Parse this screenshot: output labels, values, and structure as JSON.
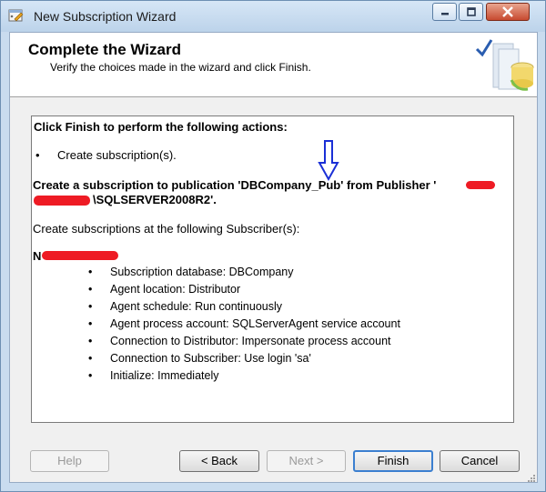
{
  "window": {
    "title": "New Subscription Wizard"
  },
  "header": {
    "title": "Complete the Wizard",
    "subtitle": "Verify the choices made in the wizard and click Finish."
  },
  "summary": {
    "heading": "Click Finish to perform the following actions:",
    "actions": [
      "Create subscription(s)."
    ],
    "publication_line1": "Create a subscription to publication 'DBCompany_Pub' from Publisher '",
    "publication_line2": "\\SQLSERVER2008R2'.",
    "subscribers_heading": "Create subscriptions at the following Subscriber(s):",
    "subscriber_name": "N",
    "properties": [
      "Subscription database: DBCompany",
      "Agent location: Distributor",
      "Agent schedule: Run continuously",
      "Agent process account: SQLServerAgent service account",
      "Connection to Distributor: Impersonate process account",
      "Connection to Subscriber: Use login 'sa'",
      "Initialize: Immediately"
    ]
  },
  "buttons": {
    "help": "Help",
    "back": "< Back",
    "next": "Next >",
    "finish": "Finish",
    "cancel": "Cancel"
  },
  "colors": {
    "redaction": "#ee1b24",
    "annotation_arrow": "#1a2fd6",
    "check": "#2a5db0"
  }
}
